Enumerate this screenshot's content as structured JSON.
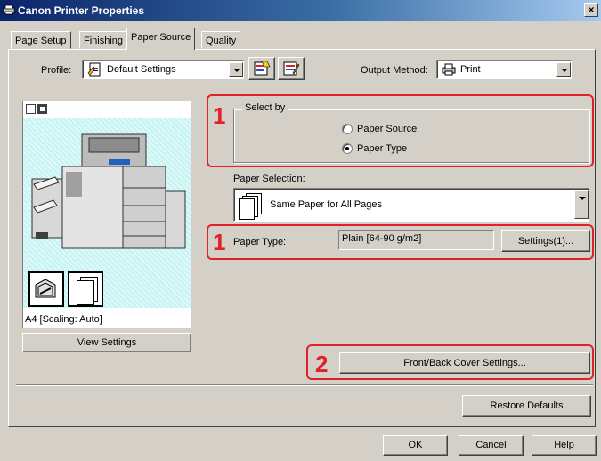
{
  "window": {
    "title": "Canon Printer Properties",
    "close_glyph": "×"
  },
  "tabs": [
    {
      "label": "Page Setup",
      "active": false
    },
    {
      "label": "Finishing",
      "active": false
    },
    {
      "label": "Paper Source",
      "active": true
    },
    {
      "label": "Quality",
      "active": false
    }
  ],
  "profile": {
    "label": "Profile:",
    "value": "Default Settings"
  },
  "output_method": {
    "label": "Output Method:",
    "value": "Print"
  },
  "select_by": {
    "legend": "Select by",
    "options": [
      {
        "label": "Paper Source",
        "selected": false
      },
      {
        "label": "Paper Type",
        "selected": true
      }
    ]
  },
  "paper_selection": {
    "label": "Paper Selection:",
    "value": "Same Paper for All Pages"
  },
  "paper_type": {
    "label": "Paper Type:",
    "value": "Plain [64-90 g/m2]",
    "settings_label": "Settings(1)..."
  },
  "preview": {
    "caption": "A4 [Scaling: Auto]",
    "view_settings_label": "View Settings"
  },
  "callouts": {
    "one_a": "1",
    "one_b": "1",
    "two": "2"
  },
  "cover_button": "Front/Back Cover Settings...",
  "restore_defaults": "Restore Defaults",
  "footer": {
    "ok": "OK",
    "cancel": "Cancel",
    "help": "Help"
  },
  "colors": {
    "title_bar": "#0a246a",
    "callout_red": "#e0202a",
    "face": "#d4d0c8",
    "preview_bg": "#c8f4f4"
  }
}
